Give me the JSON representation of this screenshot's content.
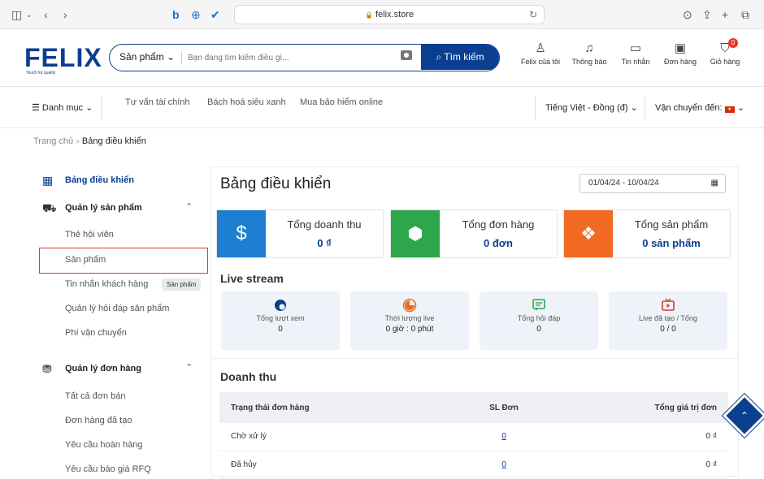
{
  "browser": {
    "url": "felix.store",
    "lock": "🔒",
    "reload": "↻"
  },
  "logo": {
    "text": "ELIX",
    "tagline": "Touch for quality"
  },
  "search": {
    "category": "Sản phẩm",
    "placeholder": "Bạn đang tìm kiếm điều gì...",
    "button": "Tìm kiếm"
  },
  "header_nav": [
    {
      "label": "Felix của tôi",
      "icon": "user-icon"
    },
    {
      "label": "Thông báo",
      "icon": "bell-icon"
    },
    {
      "label": "Tin nhắn",
      "icon": "chat-icon"
    },
    {
      "label": "Đơn hàng",
      "icon": "order-icon"
    },
    {
      "label": "Giỏ hàng",
      "icon": "cart-icon",
      "badge": "0"
    }
  ],
  "catbar": {
    "menu": "Danh mục",
    "links": [
      "Tư vấn tài chính",
      "Bách hoá siêu xanh",
      "Mua bảo hiểm online"
    ],
    "language": "Tiếng Việt - Đồng (đ)",
    "shipping": "Vận chuyển đến:"
  },
  "breadcrumb": {
    "home": "Trang chủ",
    "sep": ">",
    "current": "Bảng điều khiển"
  },
  "sidebar": {
    "dashboard": "Bảng điều khiển",
    "products_group": "Quản lý sản phẩm",
    "product_items": [
      "Thẻ hội viên",
      "Sản phẩm",
      "Tin nhắn khách hàng",
      "Quản lý hỏi đáp sản phẩm",
      "Phí vận chuyển"
    ],
    "orders_group": "Quản lý đơn hàng",
    "order_items": [
      "Tất cả đơn bán",
      "Đơn hàng đã tạo",
      "Yêu cầu hoàn hàng",
      "Yêu cầu báo giá RFQ"
    ],
    "tooltip": "Sản phẩm"
  },
  "main": {
    "title": "Bảng điều khiển",
    "date_range": "01/04/24 - 10/04/24",
    "stats": [
      {
        "label": "Tổng doanh thu",
        "value": "0 ₫",
        "color": "#1e7fd0",
        "icon": "dollar-icon"
      },
      {
        "label": "Tổng đơn hàng",
        "value": "0 đơn",
        "color": "#2ea64c",
        "icon": "boxes-icon"
      },
      {
        "label": "Tổng sản phẩm",
        "value": "0 sản phẩm",
        "color": "#f26a21",
        "icon": "gift-icon"
      }
    ],
    "live_title": "Live stream",
    "live": [
      {
        "label": "Tổng lượt xem",
        "value": "0",
        "icon": "eye-icon",
        "color": "#0a3f8f"
      },
      {
        "label": "Thời lượng live",
        "value": "0 giờ : 0 phút",
        "icon": "clock-icon",
        "color": "#f26a21"
      },
      {
        "label": "Tổng hỏi đáp",
        "value": "0",
        "icon": "qa-icon",
        "color": "#2ea64c"
      },
      {
        "label": "Live đã tạo / Tổng",
        "value": "0 / 0",
        "icon": "tv-icon",
        "color": "#e0342a"
      }
    ],
    "revenue_title": "Doanh thu",
    "table": {
      "headers": [
        "Trạng thái đơn hàng",
        "SL Đơn",
        "Tổng giá trị đơn"
      ],
      "rows": [
        [
          "Chờ xử lý",
          "0",
          "0 ₫"
        ],
        [
          "Đã hủy",
          "0",
          "0 ₫"
        ]
      ]
    }
  }
}
